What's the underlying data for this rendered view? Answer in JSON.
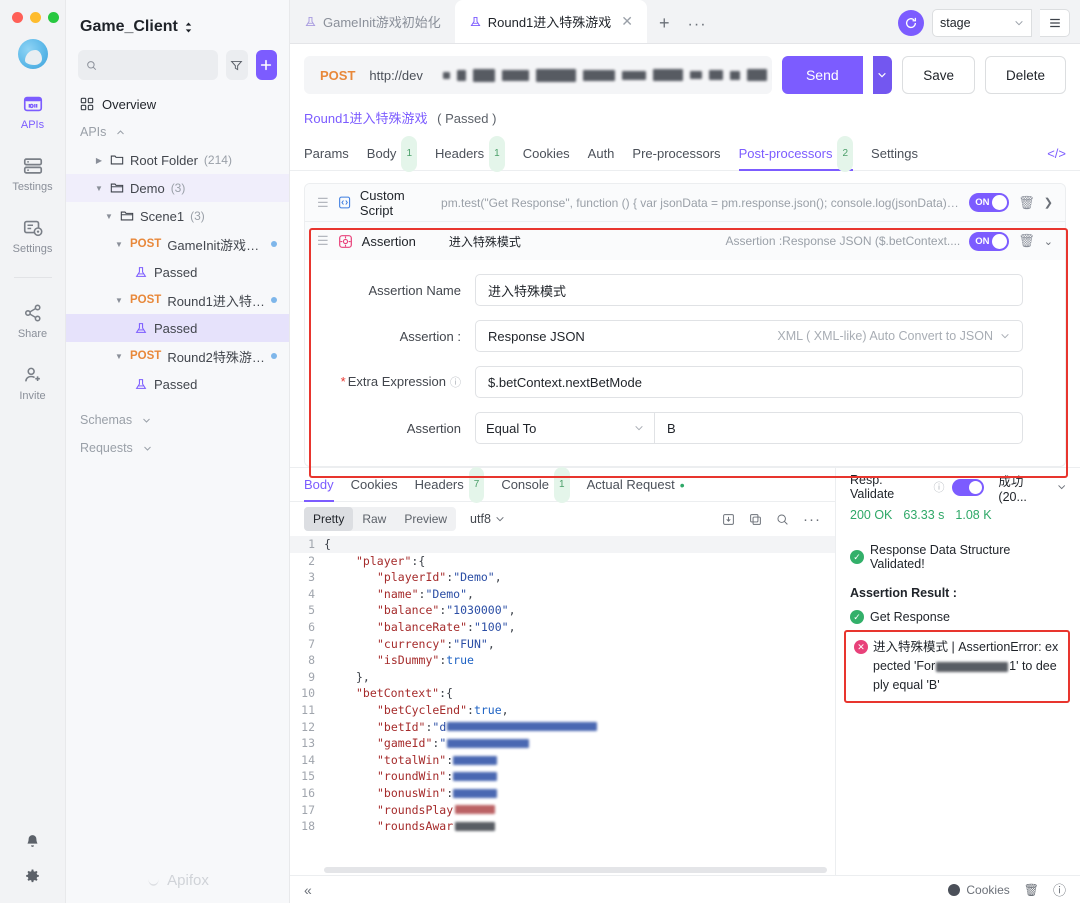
{
  "window": {
    "traffic_lights": [
      "close",
      "minimize",
      "zoom"
    ]
  },
  "rail": {
    "items": [
      {
        "label": "APIs",
        "icon": "apis-icon",
        "active": true
      },
      {
        "label": "Testings",
        "icon": "testings-icon",
        "active": false
      },
      {
        "label": "Settings",
        "icon": "settings-icon",
        "active": false
      },
      {
        "label": "Share",
        "icon": "share-icon",
        "active": false
      },
      {
        "label": "Invite",
        "icon": "invite-icon",
        "active": false
      }
    ],
    "bottom": [
      {
        "label": "",
        "icon": "bell-icon"
      },
      {
        "label": "",
        "icon": "gear-icon"
      }
    ]
  },
  "sidebar": {
    "project_title": "Game_Client",
    "search_placeholder": "",
    "filter_icon": "filter-icon",
    "add_label": "+",
    "overview_label": "Overview",
    "groups": [
      {
        "label": "APIs",
        "collapsed": false
      },
      {
        "label": "Schemas",
        "collapsed": true
      },
      {
        "label": "Requests",
        "collapsed": true
      }
    ],
    "tree": [
      {
        "type": "folder",
        "label": "Root Folder",
        "count": "(214)",
        "depth": 1,
        "expanded": false
      },
      {
        "type": "folder",
        "label": "Demo",
        "count": "(3)",
        "depth": 1,
        "expanded": true,
        "highlight": true
      },
      {
        "type": "folder",
        "label": "Scene1",
        "count": "(3)",
        "depth": 2,
        "expanded": true
      },
      {
        "type": "api",
        "method": "POST",
        "label": "GameInit游戏初始化...",
        "depth": 3,
        "expanded": true,
        "dot": true
      },
      {
        "type": "case",
        "label": "Passed",
        "depth": 4
      },
      {
        "type": "api",
        "method": "POST",
        "label": "Round1进入特殊游戏...",
        "depth": 3,
        "expanded": true,
        "dot": true
      },
      {
        "type": "case",
        "label": "Passed",
        "depth": 4,
        "selected": true
      },
      {
        "type": "api",
        "method": "POST",
        "label": "Round2特殊游戏奖励...",
        "depth": 3,
        "expanded": true,
        "dot": true
      },
      {
        "type": "case",
        "label": "Passed",
        "depth": 4
      }
    ],
    "footer_brand": "Apifox"
  },
  "doc_tabs": {
    "tabs": [
      {
        "label": "GameInit游戏初始化",
        "active": false,
        "icon": "test-case-icon"
      },
      {
        "label": "Round1进入特殊游戏",
        "active": true,
        "icon": "test-case-icon",
        "closable": true
      }
    ],
    "new_tab": "+",
    "more": "···",
    "sync_icon": "sync-icon",
    "environment": "stage",
    "env_menu_icon": "list-icon"
  },
  "request": {
    "method": "POST",
    "url": "http://dev",
    "url_redacted": true,
    "send_label": "Send",
    "save_label": "Save",
    "delete_label": "Delete"
  },
  "breadcrumb": {
    "name": "Round1进入特殊游戏",
    "status": "( Passed )"
  },
  "request_tabs": [
    {
      "label": "Params",
      "badge": "",
      "active": false
    },
    {
      "label": "Body",
      "badge": "1",
      "active": false
    },
    {
      "label": "Headers",
      "badge": "1",
      "active": false
    },
    {
      "label": "Cookies",
      "badge": "",
      "active": false
    },
    {
      "label": "Auth",
      "badge": "",
      "active": false
    },
    {
      "label": "Pre-processors",
      "badge": "",
      "active": false
    },
    {
      "label": "Post-processors",
      "badge": "2",
      "active": true
    },
    {
      "label": "Settings",
      "badge": "",
      "active": false
    }
  ],
  "processors": [
    {
      "title": "Custom Script",
      "icon": "script-icon",
      "subtitle": "pm.test(\"Get Response\", function () { var jsonData = pm.response.json(); console.log(jsonData) // we update ...",
      "right_text": "",
      "toggle": "ON",
      "expanded": false
    },
    {
      "title": "Assertion",
      "icon": "assertion-icon",
      "subtitle": "进入特殊模式",
      "right_text": "Assertion :Response JSON ($.betContext....",
      "toggle": "ON",
      "expanded": true
    }
  ],
  "assertion_form": {
    "name_label": "Assertion Name",
    "name_value": "进入特殊模式",
    "source_label": "Assertion :",
    "source_value": "Response JSON",
    "source_hint": "XML ( XML-like) Auto Convert to JSON",
    "expression_label": "Extra Expression",
    "expression_required": "*",
    "expression_value": "$.betContext.nextBetMode",
    "compare_label": "Assertion",
    "compare_op": "Equal To",
    "compare_value": "B"
  },
  "response": {
    "tabs": [
      {
        "label": "Body",
        "badge": "",
        "active": true
      },
      {
        "label": "Cookies",
        "badge": "",
        "active": false
      },
      {
        "label": "Headers",
        "badge": "7",
        "active": false
      },
      {
        "label": "Console",
        "badge": "1",
        "active": false
      },
      {
        "label": "Actual Request",
        "badge": "•",
        "active": false
      }
    ],
    "view_modes": [
      "Pretty",
      "Raw",
      "Preview"
    ],
    "view_active": "Pretty",
    "encoding": "utf8",
    "icons": [
      "download-icon",
      "copy-icon",
      "search-icon",
      "more-icon"
    ],
    "body_lines": [
      {
        "n": 1,
        "indent": 0,
        "text": "{",
        "type": "punct"
      },
      {
        "n": 2,
        "indent": 1,
        "key": "\"player\"",
        "sep": ": ",
        "val": "{",
        "type": "open"
      },
      {
        "n": 3,
        "indent": 2,
        "key": "\"playerId\"",
        "sep": ": ",
        "val": "\"Demo\"",
        "type": "string",
        "tail": ","
      },
      {
        "n": 4,
        "indent": 2,
        "key": "\"name\"",
        "sep": ": ",
        "val": "\"Demo\"",
        "type": "string",
        "tail": ","
      },
      {
        "n": 5,
        "indent": 2,
        "key": "\"balance\"",
        "sep": ": ",
        "val": "\"1030000\"",
        "type": "string",
        "tail": ","
      },
      {
        "n": 6,
        "indent": 2,
        "key": "\"balanceRate\"",
        "sep": ": ",
        "val": "\"100\"",
        "type": "string",
        "tail": ","
      },
      {
        "n": 7,
        "indent": 2,
        "key": "\"currency\"",
        "sep": ": ",
        "val": "\"FUN\"",
        "type": "string",
        "tail": ","
      },
      {
        "n": 8,
        "indent": 2,
        "key": "\"isDummy\"",
        "sep": ": ",
        "val": "true",
        "type": "bool"
      },
      {
        "n": 9,
        "indent": 1,
        "text": "},",
        "type": "punct"
      },
      {
        "n": 10,
        "indent": 1,
        "key": "\"betContext\"",
        "sep": ": ",
        "val": "{",
        "type": "open"
      },
      {
        "n": 11,
        "indent": 2,
        "key": "\"betCycleEnd\"",
        "sep": ": ",
        "val": "true",
        "type": "bool",
        "tail": ","
      },
      {
        "n": 12,
        "indent": 2,
        "key": "\"betId\"",
        "sep": ": ",
        "val": "\"d",
        "type": "redacted",
        "redact_w": 150
      },
      {
        "n": 13,
        "indent": 2,
        "key": "\"gameId\"",
        "sep": ": ",
        "val": "\" ",
        "type": "redacted",
        "redact_w": 82
      },
      {
        "n": 14,
        "indent": 2,
        "key": "\"totalWin\"",
        "sep": ":  ",
        "val": "",
        "type": "redacted",
        "redact_w": 44
      },
      {
        "n": 15,
        "indent": 2,
        "key": "\"roundWin\"",
        "sep": ":  ",
        "val": "",
        "type": "redacted",
        "redact_w": 44
      },
      {
        "n": 16,
        "indent": 2,
        "key": "\"bonusWin\"",
        "sep": ":  ",
        "val": "",
        "type": "redacted",
        "redact_w": 44
      },
      {
        "n": 17,
        "indent": 2,
        "key": "\"roundsPlay",
        "sep": "",
        "val": "",
        "type": "redacted",
        "redact_w": 40
      },
      {
        "n": 18,
        "indent": 2,
        "key": "\"roundsAwar",
        "sep": "",
        "val": "",
        "type": "redacted",
        "redact_w": 40
      }
    ]
  },
  "validate": {
    "title": "Resp. Validate",
    "help_icon": "question-icon",
    "toggle_on": true,
    "status_select": "成功 (20...",
    "status_code": "200 OK",
    "time": "63.33 s",
    "size": "1.08 K",
    "structure_ok": "Response Data Structure Validated!",
    "assertion_title": "Assertion Result :",
    "assertion_pass": "Get Response",
    "assertion_fail": "进入特殊模式 | AssertionError: expected 'For",
    "assertion_fail_tail": "1' to deeply equal 'B'",
    "assertion_fail_redacted": true
  },
  "statusbar": {
    "collapse_icon": "«",
    "cookies_label": "Cookies",
    "trash_icon": "trash-icon",
    "help_icon": "help-icon"
  },
  "colors": {
    "accent": "#7c5cff",
    "method_post": "#e8883a",
    "success": "#2fa868",
    "error": "#e8352e",
    "highlight_border": "#e8352e"
  }
}
